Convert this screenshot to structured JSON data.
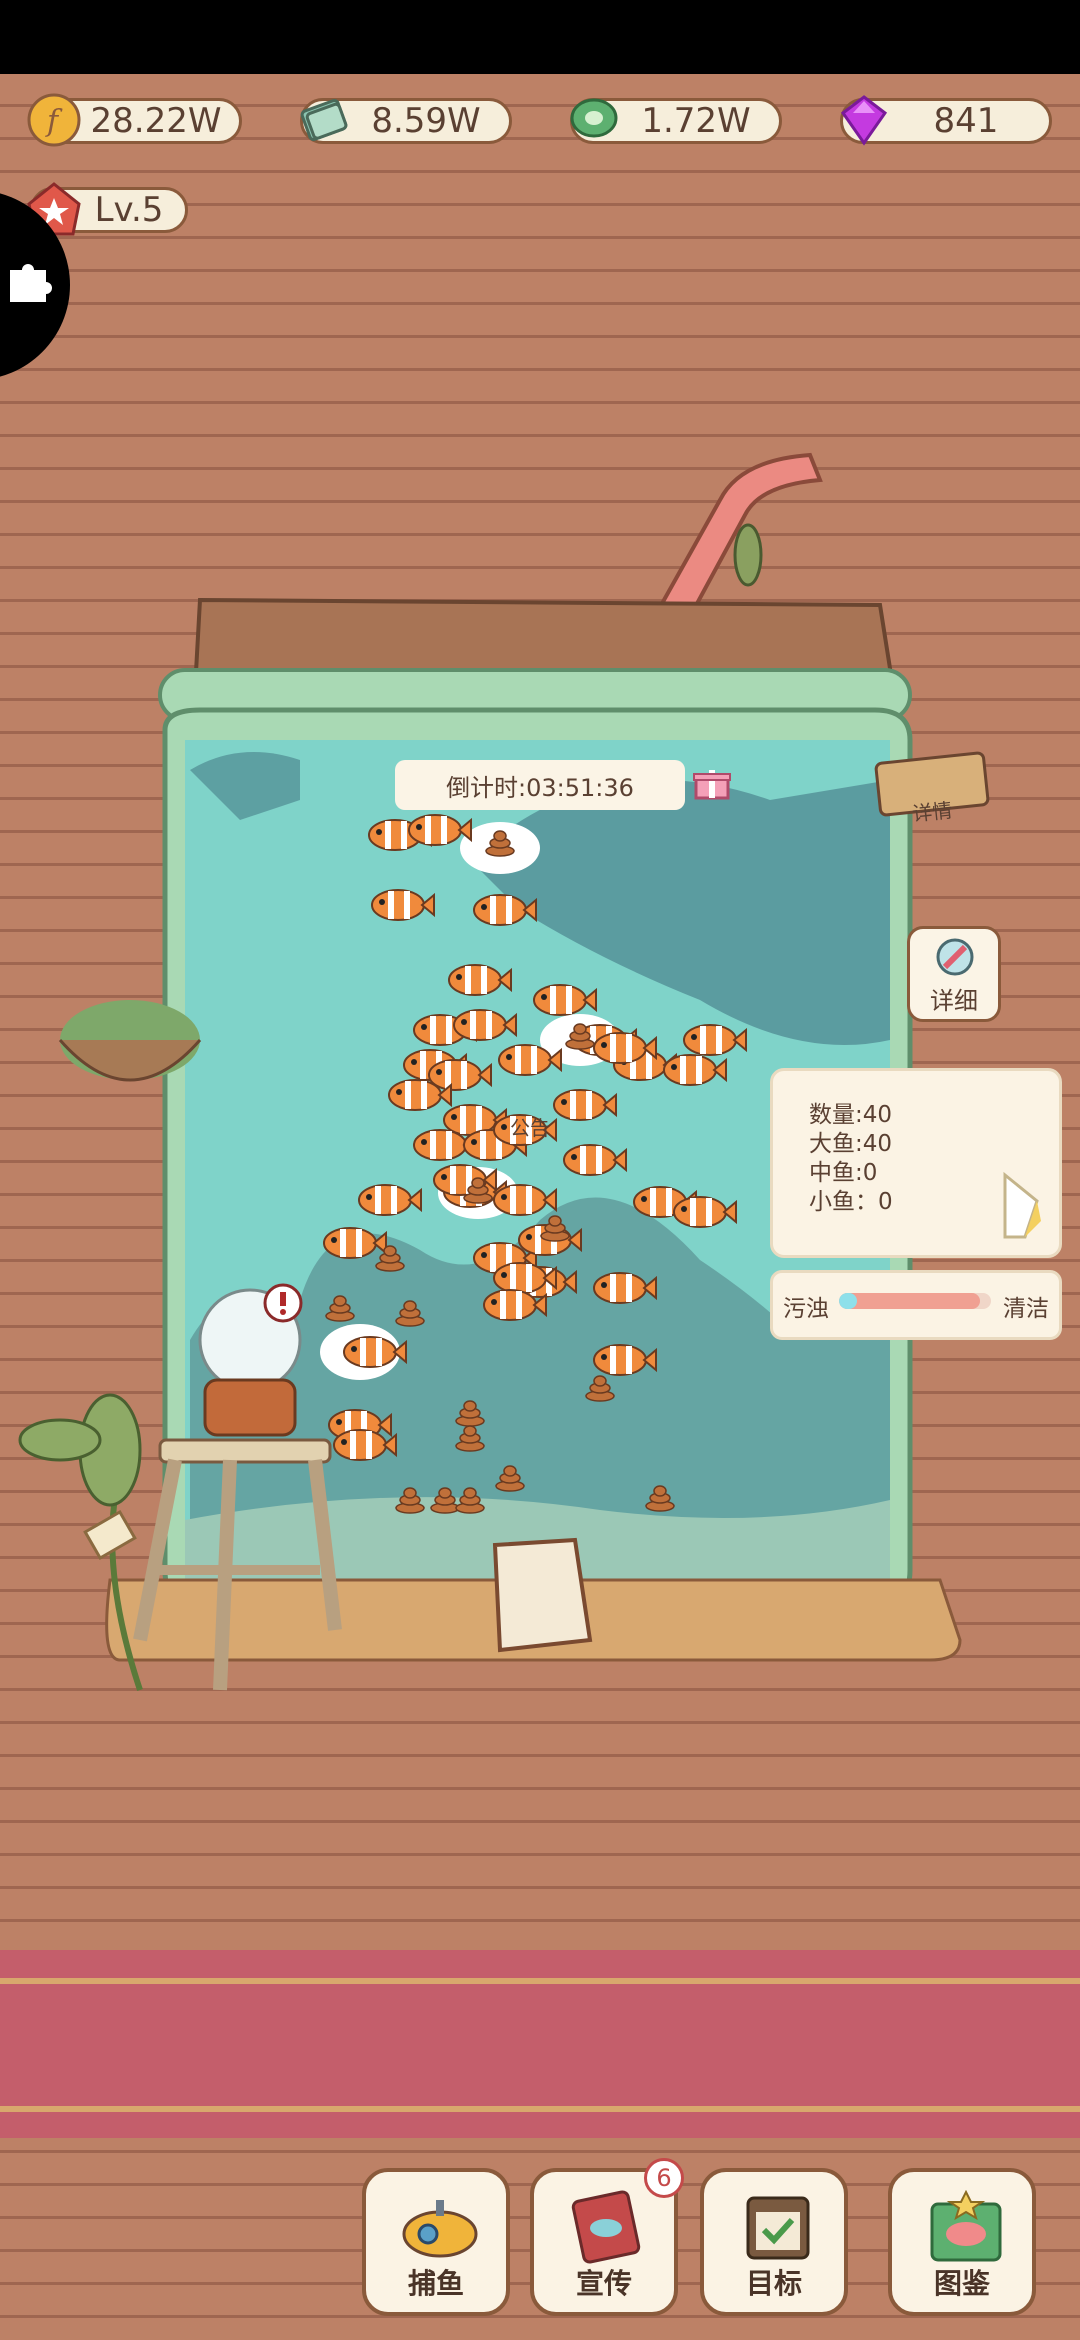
{
  "resources": {
    "coins": "28.22W",
    "cash": "8.59W",
    "shells": "1.72W",
    "gems": "841"
  },
  "level": "Lv.5",
  "tank": {
    "countdown": "倒计时:03:51:36",
    "sign_hanging": "详情",
    "detail_button": "详细",
    "notice_board": "公告"
  },
  "fish_stats": {
    "total": "数量:40",
    "big": "大鱼:40",
    "medium": "中鱼:0",
    "small": "小鱼：0"
  },
  "pollution": {
    "dirty_label": "污浊",
    "clean_label": "清洁",
    "level": 0.93
  },
  "nav": {
    "catch_label": "捕鱼",
    "promote_label": "宣传",
    "promote_badge": "6",
    "goal_label": "目标",
    "gallery_label": "图鉴"
  },
  "colors": {
    "water": "#7fd3c9",
    "fish_orange": "#f08a3c",
    "wood": "#bd8166",
    "band": "#c45e6b"
  }
}
